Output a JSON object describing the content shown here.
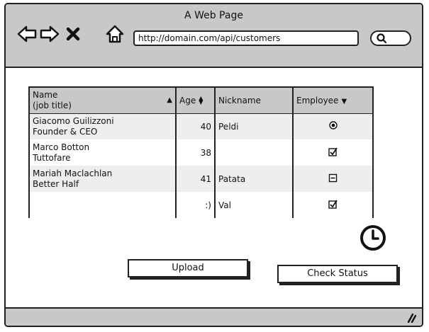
{
  "window": {
    "title": "A Web Page"
  },
  "address_bar": {
    "url": "http://domain.com/api/customers"
  },
  "nav": {
    "back_icon": "arrow-left-icon",
    "forward_icon": "arrow-right-icon",
    "stop_icon": "close-icon",
    "home_icon": "home-icon",
    "search_icon": "search-icon"
  },
  "table": {
    "headers": {
      "name": "Name",
      "name_sub": "(job title)",
      "age": "Age",
      "nickname": "Nickname",
      "employee": "Employee"
    },
    "rows": [
      {
        "name": "Giacomo Guilizzoni",
        "title": "Founder & CEO",
        "age": "40",
        "nickname": "Peldi",
        "employee": "radio-selected"
      },
      {
        "name": "Marco Botton",
        "title": "Tuttofare",
        "age": "38",
        "nickname": "",
        "employee": "checked"
      },
      {
        "name": "Mariah Maclachlan",
        "title": "Better Half",
        "age": "41",
        "nickname": "Patata",
        "employee": "indeterminate"
      },
      {
        "name": "",
        "title": "",
        "age": ":)",
        "nickname": "Val",
        "employee": "checked"
      }
    ]
  },
  "buttons": {
    "upload": "Upload",
    "check_status": "Check Status"
  },
  "colors": {
    "chrome": "#c8c8c8",
    "stroke": "#222222",
    "row_alt": "#eeeeee"
  }
}
